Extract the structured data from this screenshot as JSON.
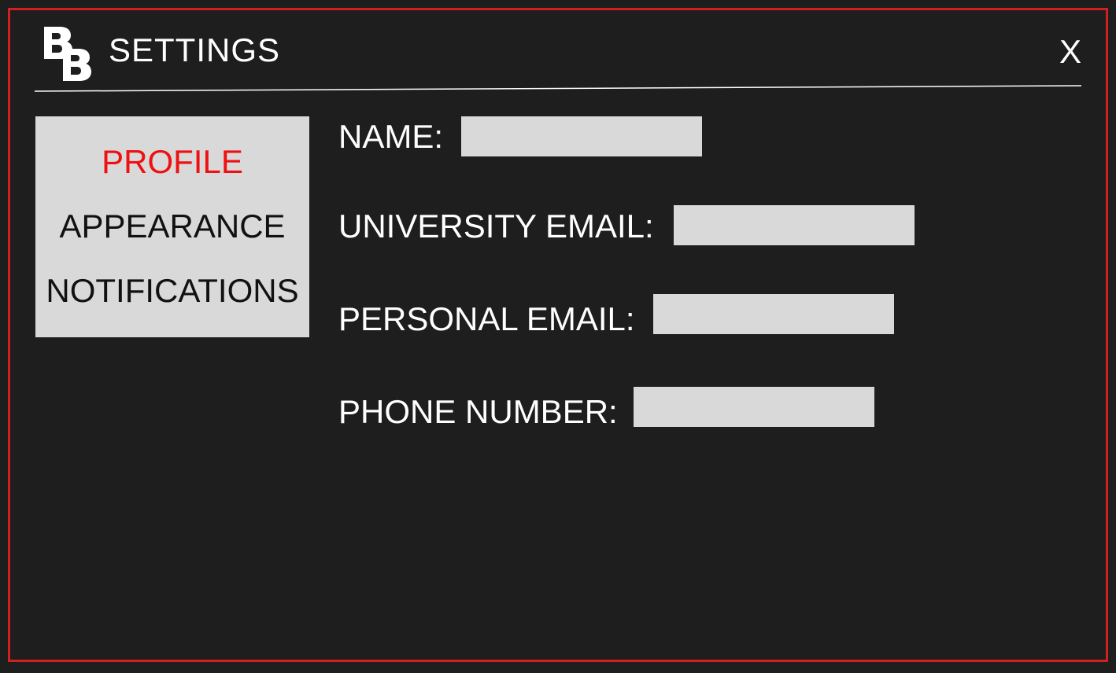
{
  "window": {
    "title": "SETTINGS",
    "close_label": "X",
    "logo_icon": "bb-logo-icon",
    "accent_color": "#d02020"
  },
  "sidebar": {
    "items": [
      {
        "label": "PROFILE",
        "active": true
      },
      {
        "label": "APPEARANCE",
        "active": false
      },
      {
        "label": "NOTIFICATIONS",
        "active": false
      }
    ],
    "active_color": "#ee1111"
  },
  "profile": {
    "fields": [
      {
        "label": "NAME:",
        "value": ""
      },
      {
        "label": "UNIVERSITY EMAIL:",
        "value": ""
      },
      {
        "label": "PERSONAL EMAIL:",
        "value": ""
      },
      {
        "label": "PHONE NUMBER:",
        "value": ""
      }
    ]
  }
}
